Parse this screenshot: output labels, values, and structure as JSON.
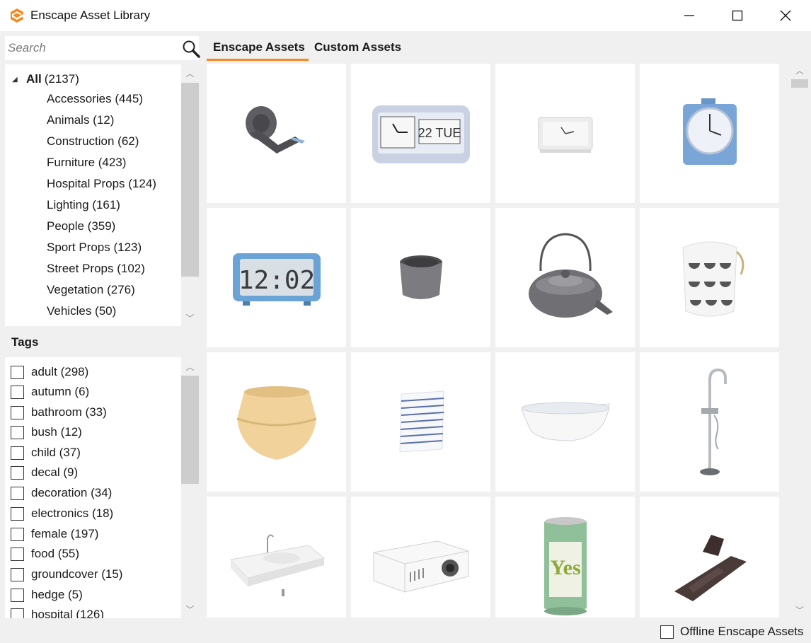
{
  "window": {
    "title": "Enscape Asset Library",
    "logo_icon": "enscape-logo-icon",
    "brand_color": "#f5891f",
    "controls": [
      "minimize-icon",
      "maximize-icon",
      "close-icon"
    ]
  },
  "search": {
    "placeholder": "Search",
    "value": "",
    "icon": "search-icon"
  },
  "categories": {
    "root": {
      "name": "All",
      "count": "(2137)",
      "expanded": true
    },
    "items": [
      {
        "label": "Accessories (445)"
      },
      {
        "label": "Animals (12)"
      },
      {
        "label": "Construction (62)"
      },
      {
        "label": "Furniture (423)"
      },
      {
        "label": "Hospital Props (124)"
      },
      {
        "label": "Lighting (161)"
      },
      {
        "label": "People (359)"
      },
      {
        "label": "Sport Props (123)"
      },
      {
        "label": "Street Props (102)"
      },
      {
        "label": "Vegetation (276)"
      },
      {
        "label": "Vehicles (50)"
      }
    ]
  },
  "tags": {
    "title": "Tags",
    "items": [
      {
        "label": "adult (298)",
        "checked": false
      },
      {
        "label": "autumn (6)",
        "checked": false
      },
      {
        "label": "bathroom (33)",
        "checked": false
      },
      {
        "label": "bush (12)",
        "checked": false
      },
      {
        "label": "child (37)",
        "checked": false
      },
      {
        "label": "decal (9)",
        "checked": false
      },
      {
        "label": "decoration (34)",
        "checked": false
      },
      {
        "label": "electronics (18)",
        "checked": false
      },
      {
        "label": "female (197)",
        "checked": false
      },
      {
        "label": "food (55)",
        "checked": false
      },
      {
        "label": "groundcover (15)",
        "checked": false
      },
      {
        "label": "hedge (5)",
        "checked": false
      },
      {
        "label": "hospital (126)",
        "checked": false
      }
    ]
  },
  "tabs": [
    {
      "label": "Enscape Assets",
      "active": true
    },
    {
      "label": "Custom Assets",
      "active": false
    }
  ],
  "assets": [
    {
      "icon": "tape-dispenser-icon"
    },
    {
      "icon": "flip-clock-icon",
      "clock_text": "22 TUE"
    },
    {
      "icon": "white-desk-clock-icon"
    },
    {
      "icon": "blue-alarm-clock-icon"
    },
    {
      "icon": "digital-clock-icon",
      "clock_text": "12:02"
    },
    {
      "icon": "metal-cup-icon"
    },
    {
      "icon": "cast-iron-teapot-icon"
    },
    {
      "icon": "patterned-basket-icon"
    },
    {
      "icon": "woven-basket-icon"
    },
    {
      "icon": "striped-towel-icon"
    },
    {
      "icon": "bathtub-icon"
    },
    {
      "icon": "floor-faucet-icon"
    },
    {
      "icon": "washbasin-icon"
    },
    {
      "icon": "projector-icon"
    },
    {
      "icon": "soda-can-icon",
      "can_text": "Yes"
    },
    {
      "icon": "binder-clip-icon"
    }
  ],
  "offline": {
    "label": "Offline Enscape Assets",
    "checked": false
  }
}
